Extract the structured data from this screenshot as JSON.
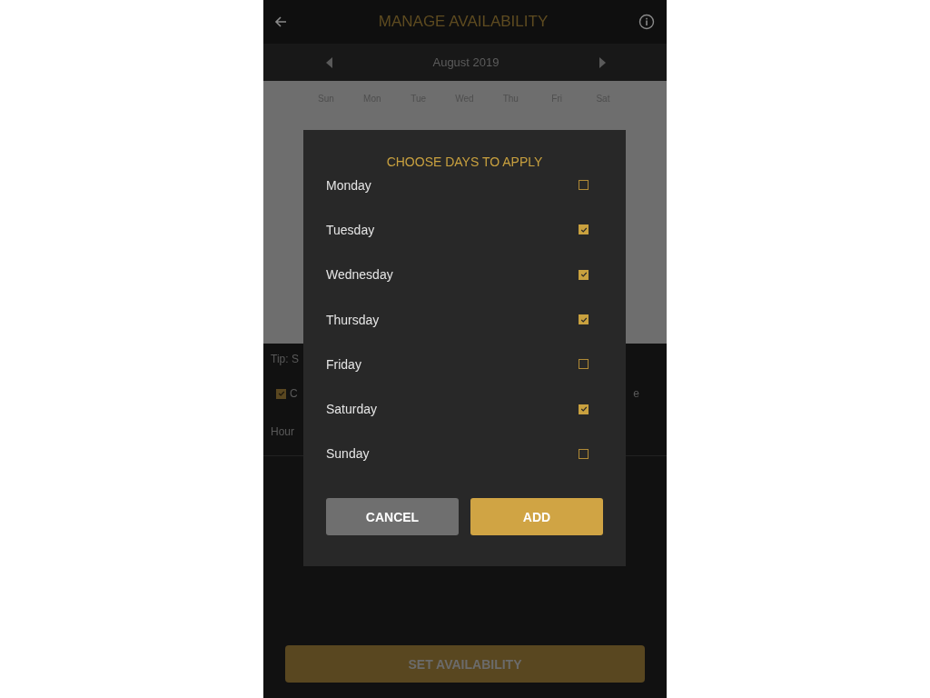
{
  "header": {
    "title": "MANAGE AVAILABILITY"
  },
  "month_bar": {
    "label": "August 2019"
  },
  "calendar": {
    "weekdays": [
      "Sun",
      "Mon",
      "Tue",
      "Wed",
      "Thu",
      "Fri",
      "Sat"
    ]
  },
  "background": {
    "tip": "Tip: S",
    "option": {
      "label": "C",
      "checked": true
    },
    "option_trailing": "e",
    "hours_label": "Hour"
  },
  "dialog": {
    "title": "CHOOSE DAYS TO APPLY",
    "days": [
      {
        "label": "Monday",
        "checked": false
      },
      {
        "label": "Tuesday",
        "checked": true
      },
      {
        "label": "Wednesday",
        "checked": true
      },
      {
        "label": "Thursday",
        "checked": true
      },
      {
        "label": "Friday",
        "checked": false
      },
      {
        "label": "Saturday",
        "checked": true
      },
      {
        "label": "Sunday",
        "checked": false
      }
    ],
    "buttons": [
      {
        "label": "CANCEL",
        "kind": "secondary"
      },
      {
        "label": "ADD",
        "kind": "primary"
      }
    ]
  },
  "footer_button": {
    "label": "SET AVAILABILITY"
  }
}
